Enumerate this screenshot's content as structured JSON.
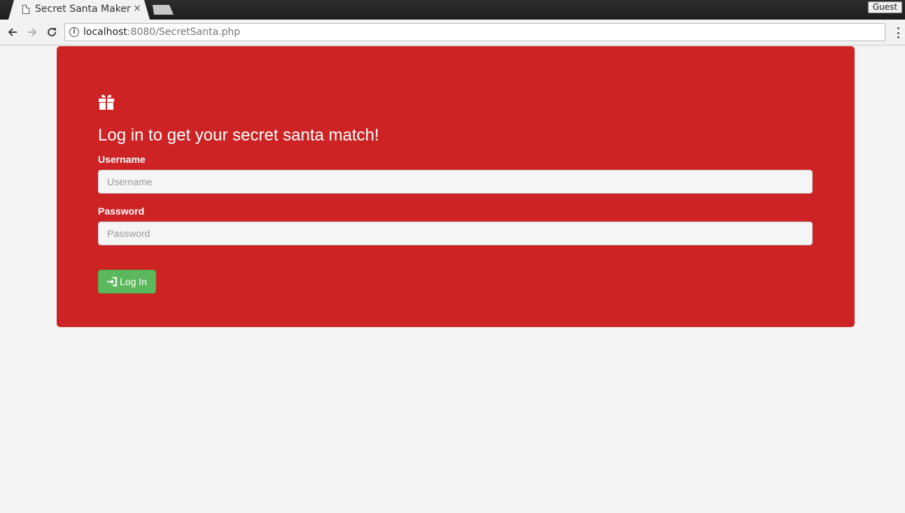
{
  "browser": {
    "tab": {
      "title": "Secret Santa Maker",
      "close_glyph": "×",
      "icon": "document-icon"
    },
    "profile_label": "Guest",
    "url": {
      "host": "localhost",
      "rest": ":8080/SecretSanta.php"
    }
  },
  "page": {
    "icon": "gift-icon",
    "heading": "Log in to get your secret santa match!",
    "username": {
      "label": "Username",
      "placeholder": "Username",
      "value": ""
    },
    "password": {
      "label": "Password",
      "placeholder": "Password",
      "value": ""
    },
    "login_button": {
      "label": "Log In",
      "icon": "sign-in-icon"
    }
  },
  "colors": {
    "panel": "#cd2324",
    "button": "#5cb85c",
    "page_bg": "#f4f4f4"
  }
}
